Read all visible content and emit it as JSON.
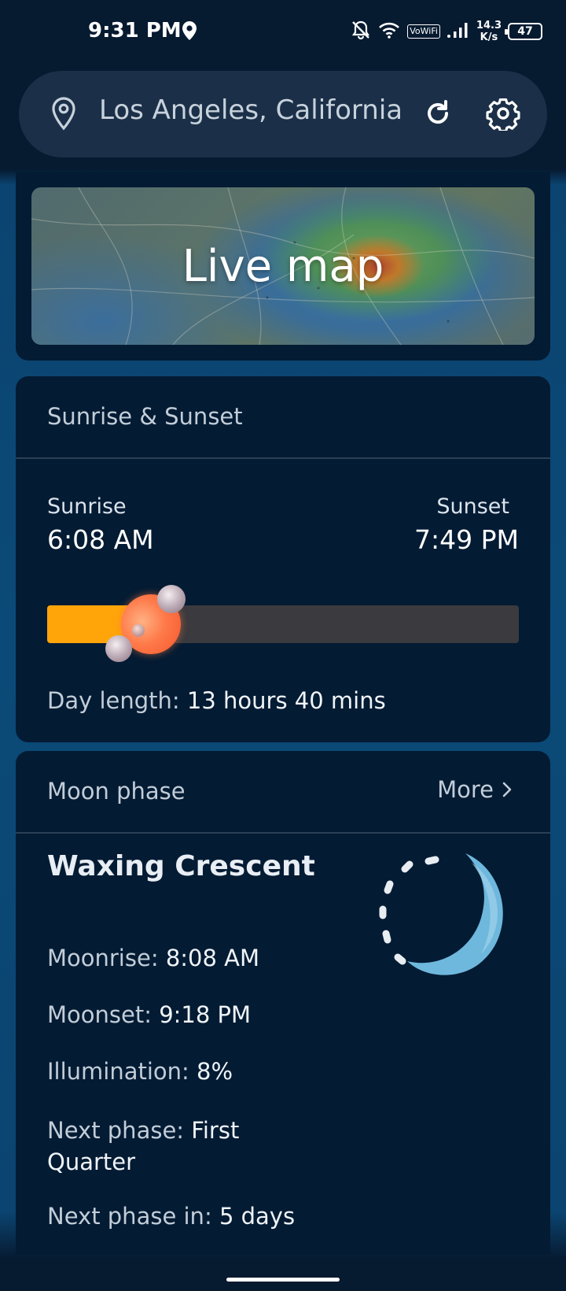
{
  "status_bar": {
    "time": "9:31 PM",
    "vowifi": "VoWiFi",
    "net_speed_value": "14.3",
    "net_speed_unit": "K/s",
    "battery": "47",
    "icons": [
      "location-icon",
      "bell-off-icon",
      "wifi-icon",
      "signal-icon",
      "battery-icon"
    ]
  },
  "search": {
    "location": "Los Angeles, California"
  },
  "live_map": {
    "label": "Live map"
  },
  "sun": {
    "title": "Sunrise & Sunset",
    "sunrise_label": "Sunrise",
    "sunrise_time": "6:08 AM",
    "sunset_label": "Sunset",
    "sunset_time": "7:49 PM",
    "day_progress": 0.22,
    "progress_color": "#ffa50a",
    "day_length_label": "Day length:",
    "day_length_value": "13 hours 40 mins"
  },
  "moon": {
    "title": "Moon phase",
    "more_label": "More",
    "phase_name": "Waxing Crescent",
    "moonrise_label": "Moonrise:",
    "moonrise_value": "8:08 AM",
    "moonset_label": "Moonset:",
    "moonset_value": "9:18 PM",
    "illumination_label": "Illumination:",
    "illumination_value": "8%",
    "next_phase_label": "Next phase:",
    "next_phase_value_line1": "First",
    "next_phase_value_line2": "Quarter",
    "next_phase_in_label": "Next phase in:",
    "next_phase_in_value": "5 days",
    "moon_color": "#6fb8dd"
  }
}
